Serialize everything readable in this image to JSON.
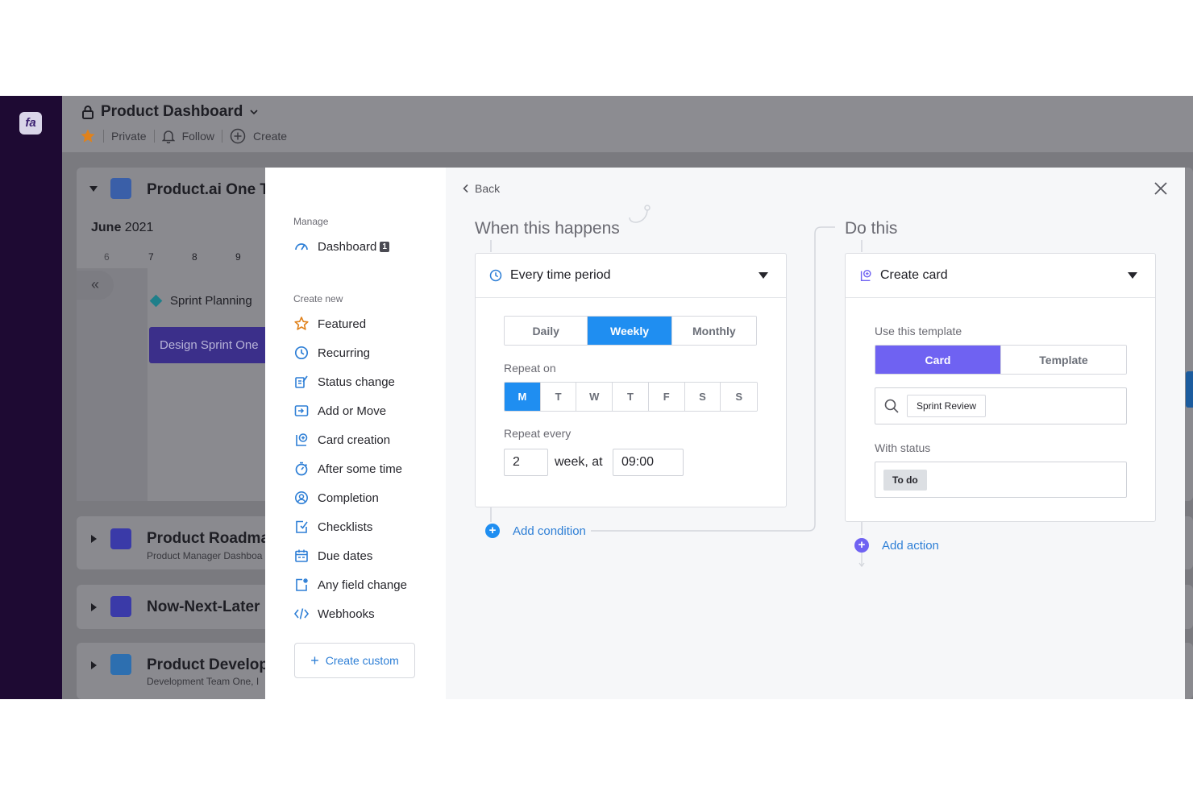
{
  "app": {
    "logo": "fa",
    "page_title": "Product Dashboard",
    "meta": {
      "private": "Private",
      "follow": "Follow",
      "create": "Create"
    }
  },
  "background": {
    "board1": {
      "title": "Product.ai One T",
      "month": "June",
      "year": "2021",
      "days": [
        "6",
        "7",
        "8",
        "9"
      ],
      "sprint_planning": "Sprint Planning",
      "design_sprint": "Design Sprint One"
    },
    "board2": {
      "title": "Product Roadma",
      "subtitle": "Product Manager Dashboa"
    },
    "board3": {
      "title": "Now-Next-Later"
    },
    "board4": {
      "title": "Product Develop",
      "subtitle": "Development Team One, I"
    }
  },
  "sidebar": {
    "manage_label": "Manage",
    "dashboard": {
      "label": "Dashboard",
      "badge": "1"
    },
    "create_new_label": "Create new",
    "items": [
      {
        "label": "Featured",
        "icon": "star-icon"
      },
      {
        "label": "Recurring",
        "icon": "clock-icon"
      },
      {
        "label": "Status change",
        "icon": "status-change-icon"
      },
      {
        "label": "Add or Move",
        "icon": "add-move-icon"
      },
      {
        "label": "Card creation",
        "icon": "card-creation-icon"
      },
      {
        "label": "After some time",
        "icon": "timer-icon"
      },
      {
        "label": "Completion",
        "icon": "completion-icon"
      },
      {
        "label": "Checklists",
        "icon": "checklist-icon"
      },
      {
        "label": "Due dates",
        "icon": "calendar-icon"
      },
      {
        "label": "Any field change",
        "icon": "field-change-icon"
      },
      {
        "label": "Webhooks",
        "icon": "code-icon"
      }
    ],
    "create_custom": "Create custom"
  },
  "main": {
    "back": "Back",
    "trigger": {
      "heading": "When this happens",
      "selected": "Every time period",
      "periods": [
        "Daily",
        "Weekly",
        "Monthly"
      ],
      "active_period": "Weekly",
      "repeat_on_label": "Repeat on",
      "weekdays": [
        "M",
        "T",
        "W",
        "T",
        "F",
        "S",
        "S"
      ],
      "active_weekday": "M",
      "repeat_every_label": "Repeat every",
      "repeat_every_value": "2",
      "unit_text": "week, at",
      "time_value": "09:00",
      "add_condition": "Add condition"
    },
    "action": {
      "heading": "Do this",
      "selected": "Create card",
      "template_label": "Use this template",
      "template_tabs": [
        "Card",
        "Template"
      ],
      "active_tab": "Card",
      "search_value": "Sprint Review",
      "status_label": "With status",
      "status_value": "To do",
      "add_action": "Add action"
    }
  },
  "colors": {
    "accent_blue": "#1f8ef1",
    "accent_purple": "#6f62f2",
    "link_blue": "#2e7fd6",
    "nav_dark": "#1e0a33"
  }
}
